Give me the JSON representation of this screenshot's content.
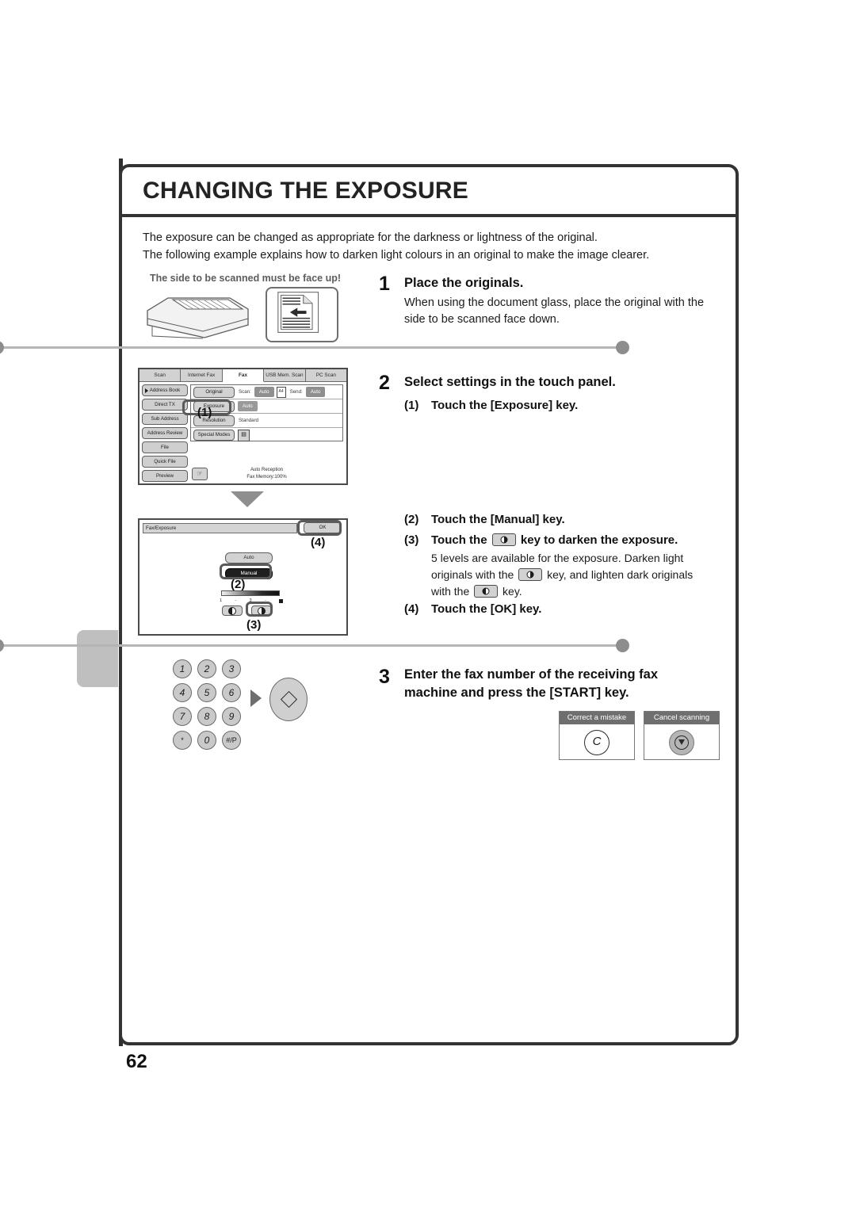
{
  "page": {
    "title": "CHANGING THE EXPOSURE",
    "page_number": "62",
    "intro_line1": "The exposure can be changed as appropriate for the darkness or lightness of the original.",
    "intro_line2": "The following example explains how to darken light colours in an original to make the image clearer."
  },
  "step1": {
    "number": "1",
    "heading": "Place the originals.",
    "body": "When using the document glass, place the original with the side to be scanned face down.",
    "illustration_caption": "The side to be scanned must be face up!",
    "mfp_icon": "mfp-scanner-icon",
    "original_icon": "original-document-icon"
  },
  "step2": {
    "number": "2",
    "heading": "Select settings in the touch panel.",
    "substeps": [
      {
        "n": "(1)",
        "text": "Touch the [Exposure] key."
      },
      {
        "n": "(2)",
        "text": "Touch the [Manual] key."
      },
      {
        "n": "(3)",
        "text_before": "Touch the",
        "text_after": "key to darken the exposure."
      },
      {
        "n": "(4)",
        "text": "Touch the [OK] key."
      }
    ],
    "substep3_body": {
      "line1": "5 levels are available for the exposure. Darken light",
      "line2_before": "originals with the",
      "line2_after": "key, and lighten dark originals",
      "line3_before": "with the",
      "line3_after": "key."
    },
    "callout_labels": [
      "(1)",
      "(2)",
      "(3)",
      "(4)"
    ],
    "arrow_icon": "arrow-down-icon"
  },
  "panel1": {
    "tabs": [
      {
        "label": "Scan",
        "active": false
      },
      {
        "label": "Internet Fax",
        "active": false
      },
      {
        "label": "Fax",
        "active": true
      },
      {
        "label": "USB Mem. Scan",
        "active": false
      },
      {
        "label": "PC Scan",
        "active": false
      }
    ],
    "left_buttons": [
      "Address Book",
      "Direct TX",
      "Sub Address",
      "Address Review",
      "File",
      "Quick File",
      "Preview"
    ],
    "rows": [
      {
        "key": "Original",
        "label1": "Scan:",
        "value1": "Auto",
        "paper": "A4",
        "label2": "Send:",
        "value2": "Auto"
      },
      {
        "key": "Exposure",
        "value1": "Auto"
      },
      {
        "key": "Resolution",
        "value1": "Standard"
      },
      {
        "key": "Special Modes",
        "icon": "document-file-icon"
      }
    ],
    "status_line1": "Auto Reception",
    "status_line2": "Fax Memory:100%",
    "hand_icon": "hand-pointer-icon"
  },
  "panel2": {
    "header": "Fax/Exposure",
    "ok_label": "OK",
    "auto_label": "Auto",
    "manual_label": "Manual",
    "slider_ticks": [
      "1",
      "-",
      "3",
      "-"
    ],
    "lighten_icon": "lighten-exposure-icon",
    "darken_icon": "darken-exposure-icon"
  },
  "step3": {
    "number": "3",
    "heading_line1": "Enter the fax number of the receiving fax",
    "heading_line2": "machine and press the [START] key.",
    "keypad": [
      [
        "1",
        "2",
        "3"
      ],
      [
        "4",
        "5",
        "6"
      ],
      [
        "7",
        "8",
        "9"
      ],
      [
        "*",
        "0",
        "#/P"
      ]
    ],
    "start_key_icon": "start-key-icon",
    "arrow_icon": "arrow-right-icon",
    "callouts": [
      {
        "caption": "Correct a mistake",
        "glyph": "C",
        "icon": "clear-key-icon"
      },
      {
        "caption": "Cancel scanning",
        "glyph": "",
        "icon": "stop-key-icon"
      }
    ]
  },
  "colors": {
    "border": "#333333",
    "rail": "#b5b5b5",
    "panel_key": "#d2d2d2",
    "selected": "#1f1f1f"
  }
}
